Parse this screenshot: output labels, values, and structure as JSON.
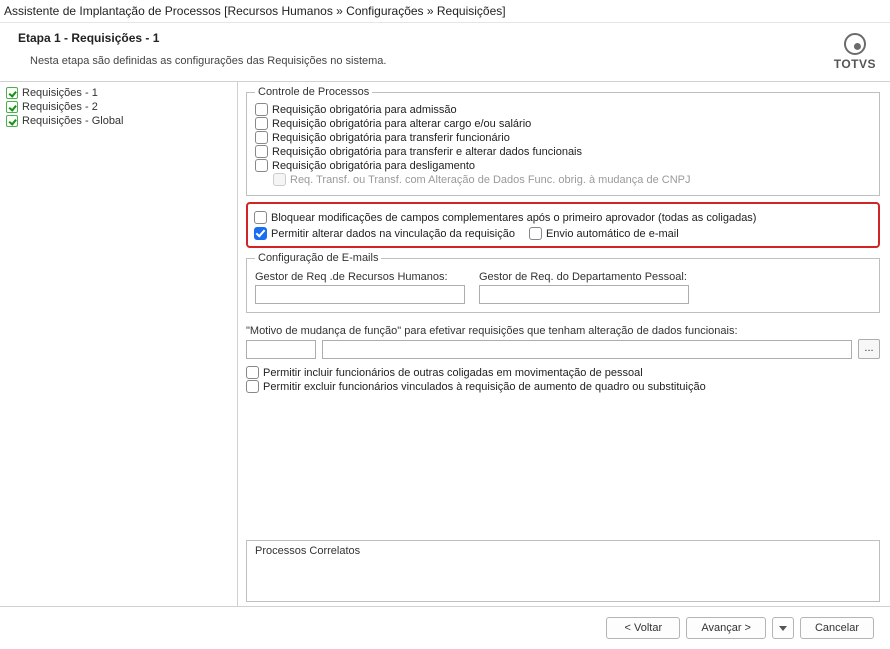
{
  "window": {
    "title": "Assistente de Implantação de Processos [Recursos Humanos » Configurações » Requisições]"
  },
  "header": {
    "title": "Etapa 1 - Requisições - 1",
    "description": "Nesta etapa são definidas as configurações das Requisições no sistema.",
    "brand": "TOTVS"
  },
  "sidebar": {
    "items": [
      {
        "label": "Requisições - 1"
      },
      {
        "label": "Requisições - 2"
      },
      {
        "label": "Requisições - Global"
      }
    ]
  },
  "controle": {
    "legend": "Controle de Processos",
    "items": {
      "admissao": "Requisição obrigatória para admissão",
      "cargo_salario": "Requisição obrigatória para alterar cargo e/ou salário",
      "transferir": "Requisição obrigatória para transferir funcionário",
      "transferir_dados": "Requisição obrigatória para transferir e alterar dados funcionais",
      "desligamento": "Requisição obrigatória para desligamento",
      "cnpj": "Req. Transf. ou Transf. com Alteração de Dados Func. obrig.  à mudança de CNPJ"
    }
  },
  "highlight": {
    "bloquear": "Bloquear modificações de campos complementares após o primeiro aprovador (todas as coligadas)",
    "permitir_alterar": "Permitir alterar dados na vinculação da requisição",
    "envio_email": "Envio automático de e-mail"
  },
  "emails": {
    "legend": "Configuração de E-mails",
    "gestor_rh_label": "Gestor de Req .de Recursos Humanos:",
    "gestor_dp_label": "Gestor de Req. do Departamento Pessoal:",
    "gestor_rh_value": "",
    "gestor_dp_value": ""
  },
  "motivo": {
    "label": "\"Motivo de mudança de função\" para efetivar requisições que tenham alteração de dados funcionais:",
    "code": "",
    "desc": "",
    "lookup": "..."
  },
  "extra": {
    "incluir_coligadas": "Permitir incluir funcionários de outras coligadas em movimentação de pessoal",
    "excluir_vinculados": "Permitir excluir funcionários vinculados à requisição de aumento de quadro ou substituição"
  },
  "correlatos": {
    "title": "Processos Correlatos"
  },
  "footer": {
    "voltar": "< Voltar",
    "avancar": "Avançar >",
    "cancelar": "Cancelar"
  }
}
